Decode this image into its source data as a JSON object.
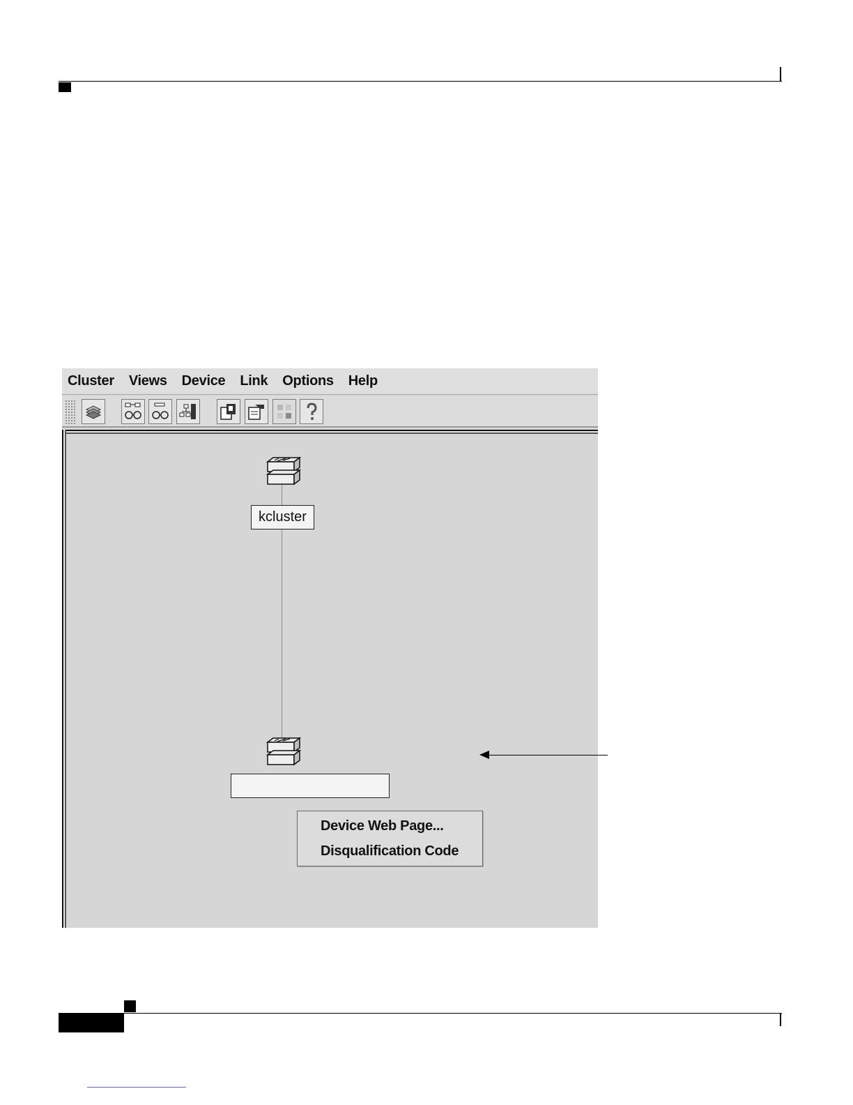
{
  "menubar": {
    "items": [
      "Cluster",
      "Views",
      "Device",
      "Link",
      "Options",
      "Help"
    ]
  },
  "toolbar": {
    "buttons": [
      {
        "icon": "stack-icon",
        "enabled": true
      },
      {
        "icon": "topology-view-icon",
        "enabled": true
      },
      {
        "icon": "cluster-view-icon",
        "enabled": true
      },
      {
        "icon": "arrange-icon",
        "enabled": true
      },
      {
        "icon": "save-layout-icon",
        "enabled": true
      },
      {
        "icon": "properties-icon",
        "enabled": true
      },
      {
        "icon": "legend-icon",
        "enabled": false
      },
      {
        "icon": "help-icon",
        "enabled": true
      }
    ]
  },
  "topology": {
    "cluster_label": "kcluster",
    "member_label": ""
  },
  "context_menu": {
    "items": [
      "Device Web Page...",
      "Disqualification Code"
    ]
  }
}
